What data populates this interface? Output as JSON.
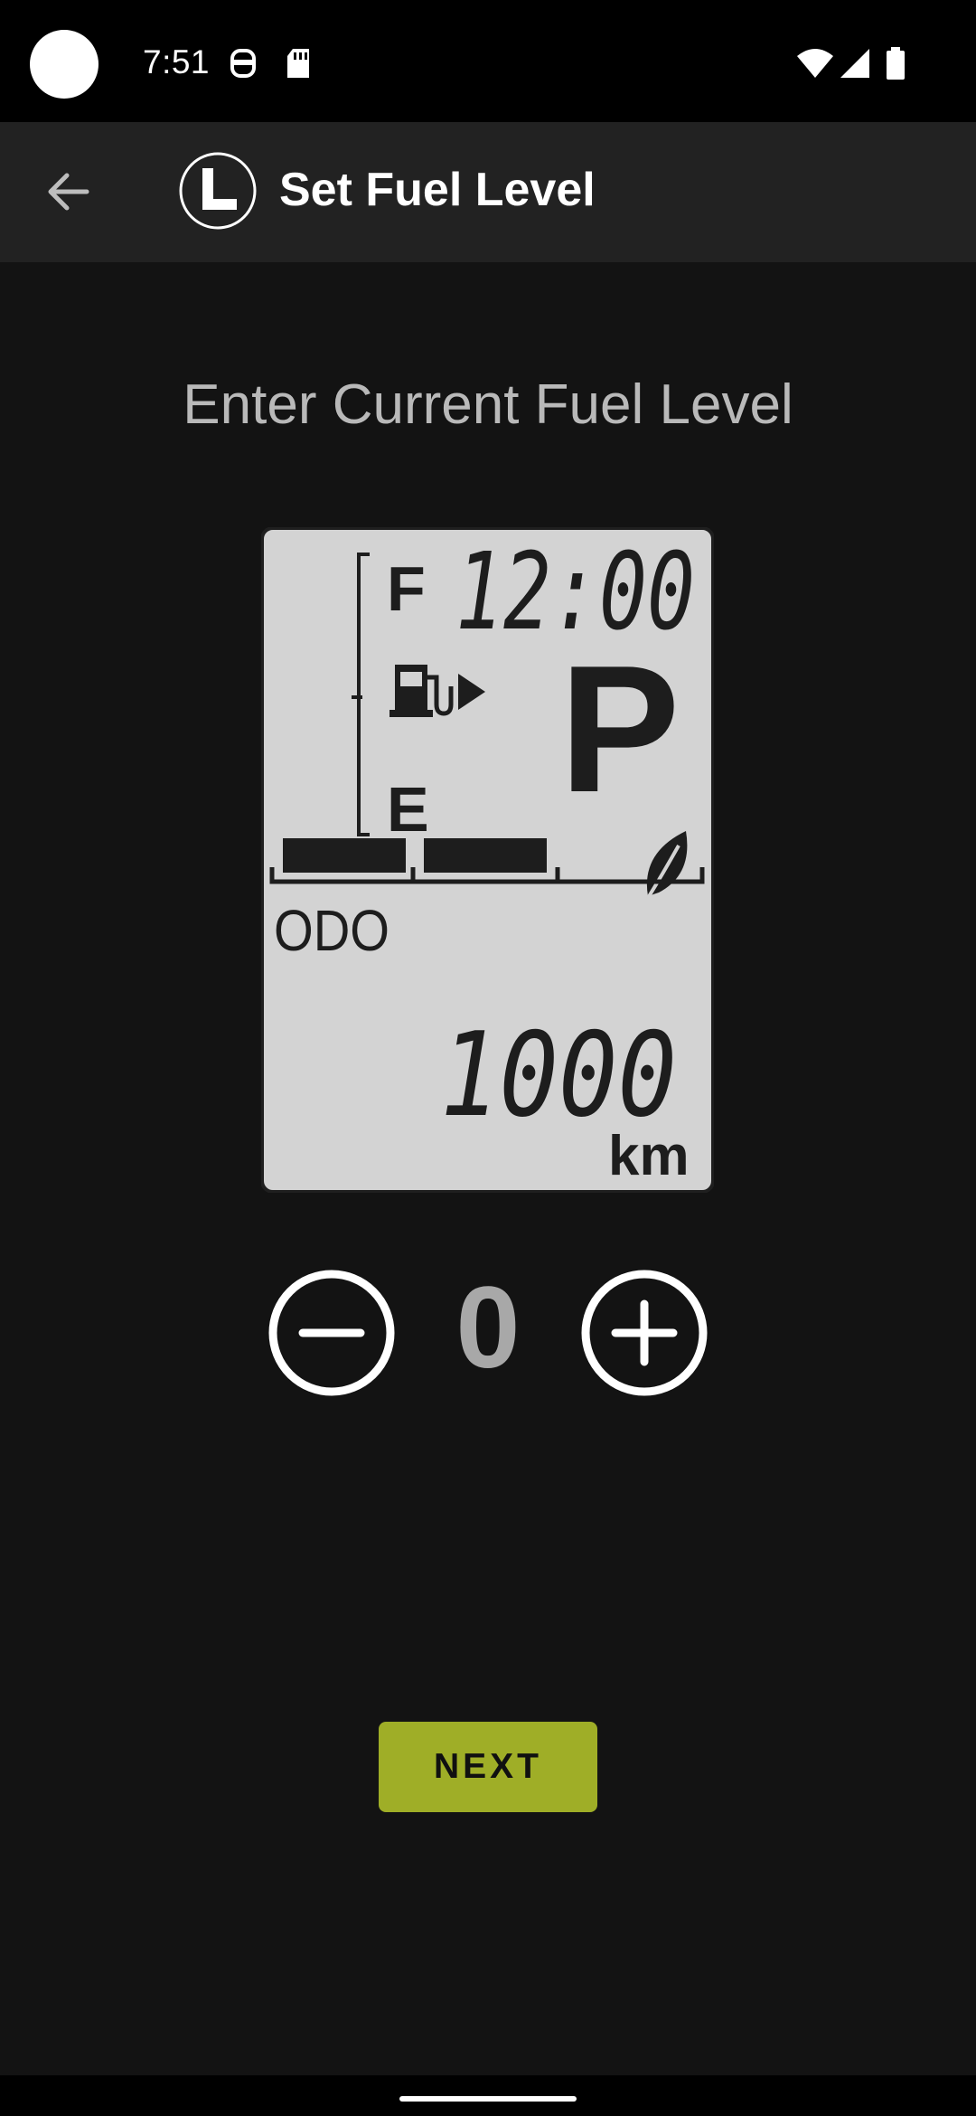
{
  "status_bar": {
    "time": "7:51"
  },
  "app_bar": {
    "title": "Set Fuel Level"
  },
  "main": {
    "heading": "Enter Current Fuel Level",
    "display": {
      "full_label": "F",
      "empty_label": "E",
      "clock": "12:00",
      "gear": "P",
      "odo_label": "ODO",
      "odometer": "1000",
      "odo_unit": "km",
      "fuel_segments_filled": 2,
      "fuel_segments_total": 3
    },
    "stepper": {
      "value": "0"
    },
    "next_label": "NEXT"
  },
  "colors": {
    "accent": "#9fae27",
    "lcd_bg": "#d3d3d3",
    "background": "#131313"
  }
}
